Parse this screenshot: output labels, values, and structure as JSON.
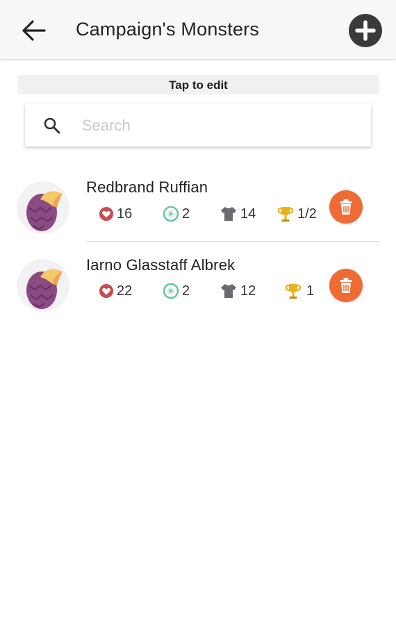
{
  "header": {
    "title": "Campaign's Monsters",
    "back_icon": "arrow-back-icon",
    "add_icon": "plus-circle-icon"
  },
  "hint": {
    "text": "Tap to edit"
  },
  "search": {
    "placeholder": "Search",
    "value": "",
    "icon": "search-icon"
  },
  "monsters": [
    {
      "name": "Redbrand Ruffian",
      "hp": "16",
      "speed": "2",
      "armor": "14",
      "challenge": "1/2",
      "avatar_icon": "dragon-egg-icon",
      "delete_icon": "trash-icon"
    },
    {
      "name": "Iarno Glasstaff Albrek",
      "hp": "22",
      "speed": "2",
      "armor": "12",
      "challenge": "1",
      "avatar_icon": "dragon-egg-icon",
      "delete_icon": "trash-icon"
    }
  ],
  "colors": {
    "app_bar": "#f7f7f7",
    "add_button": "#3a3a3a",
    "delete_button": "#f06a34",
    "heart": "#c94a52",
    "speed": "#6cc3a4",
    "armor": "#6a6a72",
    "trophy": "#e9b21d"
  }
}
